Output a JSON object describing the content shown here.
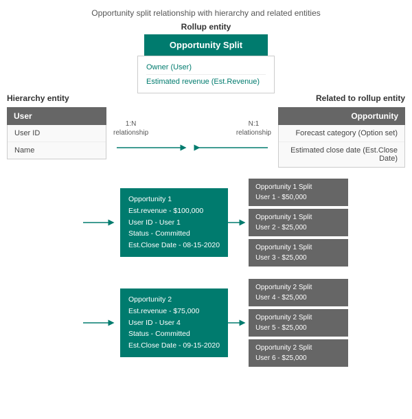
{
  "page": {
    "title": "Opportunity split relationship with hierarchy and related entities"
  },
  "rollup": {
    "label": "Rollup entity",
    "box_label": "Opportunity Split",
    "fields": [
      "Owner (User)",
      "Estimated revenue (Est.Revenue)"
    ]
  },
  "hierarchy_entity": {
    "section_label": "Hierarchy entity",
    "header": "User",
    "fields": [
      "User ID",
      "Name"
    ]
  },
  "related_entity": {
    "section_label": "Related to rollup entity",
    "header": "Opportunity",
    "fields": [
      "Forecast category (Option set)",
      "Estimated close date (Est.Close Date)"
    ]
  },
  "relationship_left": {
    "label": "1:N\nrelationship"
  },
  "relationship_right": {
    "label": "N:1\nrelationship"
  },
  "opportunities": [
    {
      "id": "opp1",
      "lines": [
        "Opportunity 1",
        "Est.revenue - $100,000",
        "User ID - User 1",
        "Status - Committed",
        "Est.Close Date - 08-15-2020"
      ],
      "splits": [
        "Opportunity 1 Split\nUser 1 - $50,000",
        "Opportunity 1 Split\nUser 2 - $25,000",
        "Opportunity 1 Split\nUser 3 - $25,000"
      ]
    },
    {
      "id": "opp2",
      "lines": [
        "Opportunity 2",
        "Est.revenue - $75,000",
        "User ID - User 4",
        "Status - Committed",
        "Est.Close Date - 09-15-2020"
      ],
      "splits": [
        "Opportunity 2 Split\nUser 4 - $25,000",
        "Opportunity 2 Split\nUser 5 - $25,000",
        "Opportunity 2 Split\nUser 6 - $25,000"
      ]
    }
  ]
}
